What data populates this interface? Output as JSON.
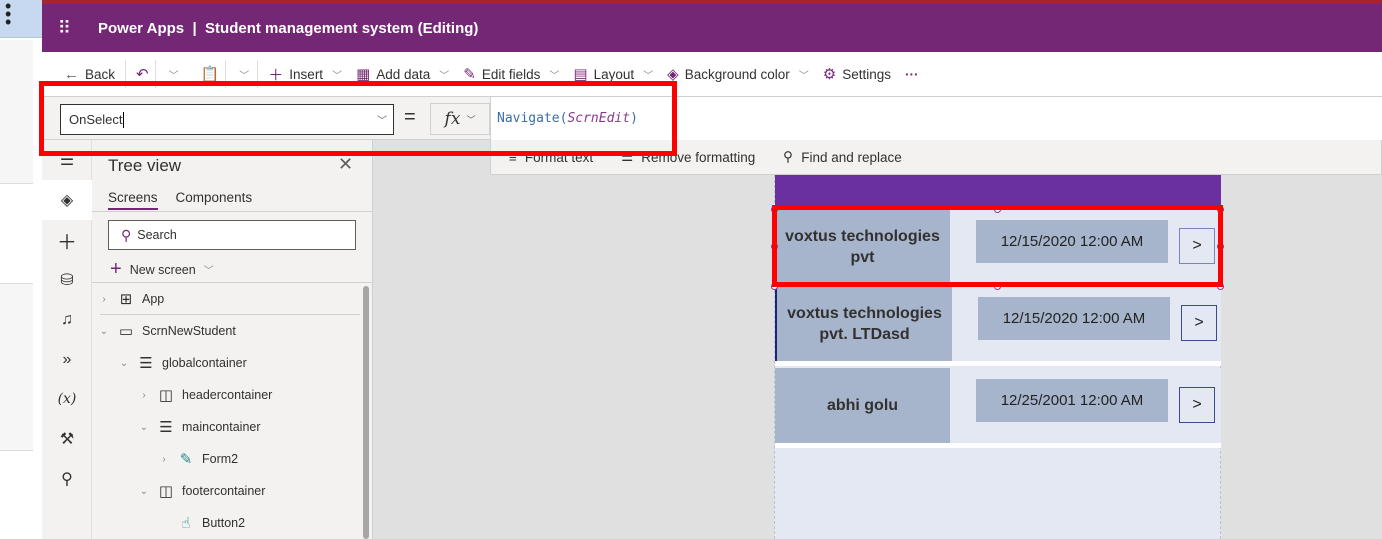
{
  "header": {
    "app_name": "Power Apps",
    "separator": "|",
    "doc_title": "Student management system (Editing)",
    "waffle_icon": "waffle-icon"
  },
  "command_bar": {
    "back": "Back",
    "insert": "Insert",
    "add_data": "Add data",
    "edit_fields": "Edit fields",
    "layout": "Layout",
    "background_color": "Background color",
    "settings": "Settings",
    "more": "···"
  },
  "formula_bar": {
    "property": "OnSelect",
    "equals": "=",
    "fx_label": "fx",
    "formula_function": "Navigate",
    "formula_open": "(",
    "formula_argument": "ScrnEdit",
    "formula_close": ")"
  },
  "format_bar": {
    "format_text": "Format text",
    "remove_formatting": "Remove formatting",
    "find_replace": "Find and replace"
  },
  "tree_view": {
    "title": "Tree view",
    "tabs": [
      {
        "label": "Screens",
        "active": true
      },
      {
        "label": "Components",
        "active": false
      }
    ],
    "search_placeholder": "Search",
    "new_screen": "New screen",
    "nodes": [
      {
        "label": "App",
        "icon": "app-icon",
        "expanded": false
      },
      {
        "label": "ScrnNewStudent",
        "icon": "screen-icon",
        "expanded": true
      },
      {
        "label": "globalcontainer",
        "icon": "vertical-container-icon",
        "expanded": true
      },
      {
        "label": "headercontainer",
        "icon": "horizontal-container-icon",
        "expanded": false
      },
      {
        "label": "maincontainer",
        "icon": "vertical-container-icon",
        "expanded": true
      },
      {
        "label": "Form2",
        "icon": "form-icon",
        "expanded": false
      },
      {
        "label": "footercontainer",
        "icon": "horizontal-container-icon",
        "expanded": true
      },
      {
        "label": "Button2",
        "icon": "button-icon",
        "expanded": null
      }
    ]
  },
  "rail": {
    "items": [
      "hamburger-icon",
      "tree-view-icon",
      "insert-icon",
      "data-icon",
      "media-icon",
      "power-automate-icon",
      "variables-icon",
      "advanced-tools-icon",
      "search-icon"
    ]
  },
  "gallery": {
    "rows": [
      {
        "name": "voxtus technologies pvt",
        "date": "12/15/2020 12:00 AM",
        "selected": true
      },
      {
        "name": "voxtus technologies pvt. LTDasd",
        "date": "12/15/2020 12:00 AM",
        "selected": false
      },
      {
        "name": "abhi golu",
        "date": "12/25/2001 12:00 AM",
        "selected": false
      }
    ],
    "arrow": ">"
  },
  "colors": {
    "brand": "#742774",
    "highlight": "#ff0000",
    "screen_header": "#6b30a0",
    "row_cell": "#a7b5cc"
  }
}
